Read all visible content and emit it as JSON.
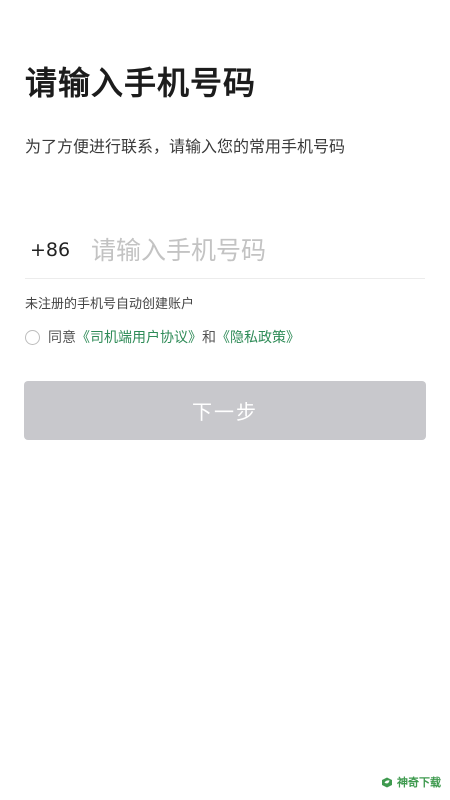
{
  "header": {
    "title": "请输入手机号码",
    "subtitle": "为了方便进行联系，请输入您的常用手机号码"
  },
  "phone": {
    "country_code": "+86",
    "value": "",
    "placeholder": "请输入手机号码"
  },
  "hint": "未注册的手机号自动创建账户",
  "agreement": {
    "checked": false,
    "prefix": "同意",
    "user_agreement": "《司机端用户协议》",
    "and": "和",
    "privacy_policy": "《隐私政策》",
    "link_color": "#2e8b57"
  },
  "next_button": {
    "label": "下一步",
    "disabled": true,
    "color": "#c8c8cc"
  },
  "watermark": {
    "text": "神奇下载",
    "icon": "leaf-box-icon",
    "color": "#3f9a4f"
  }
}
